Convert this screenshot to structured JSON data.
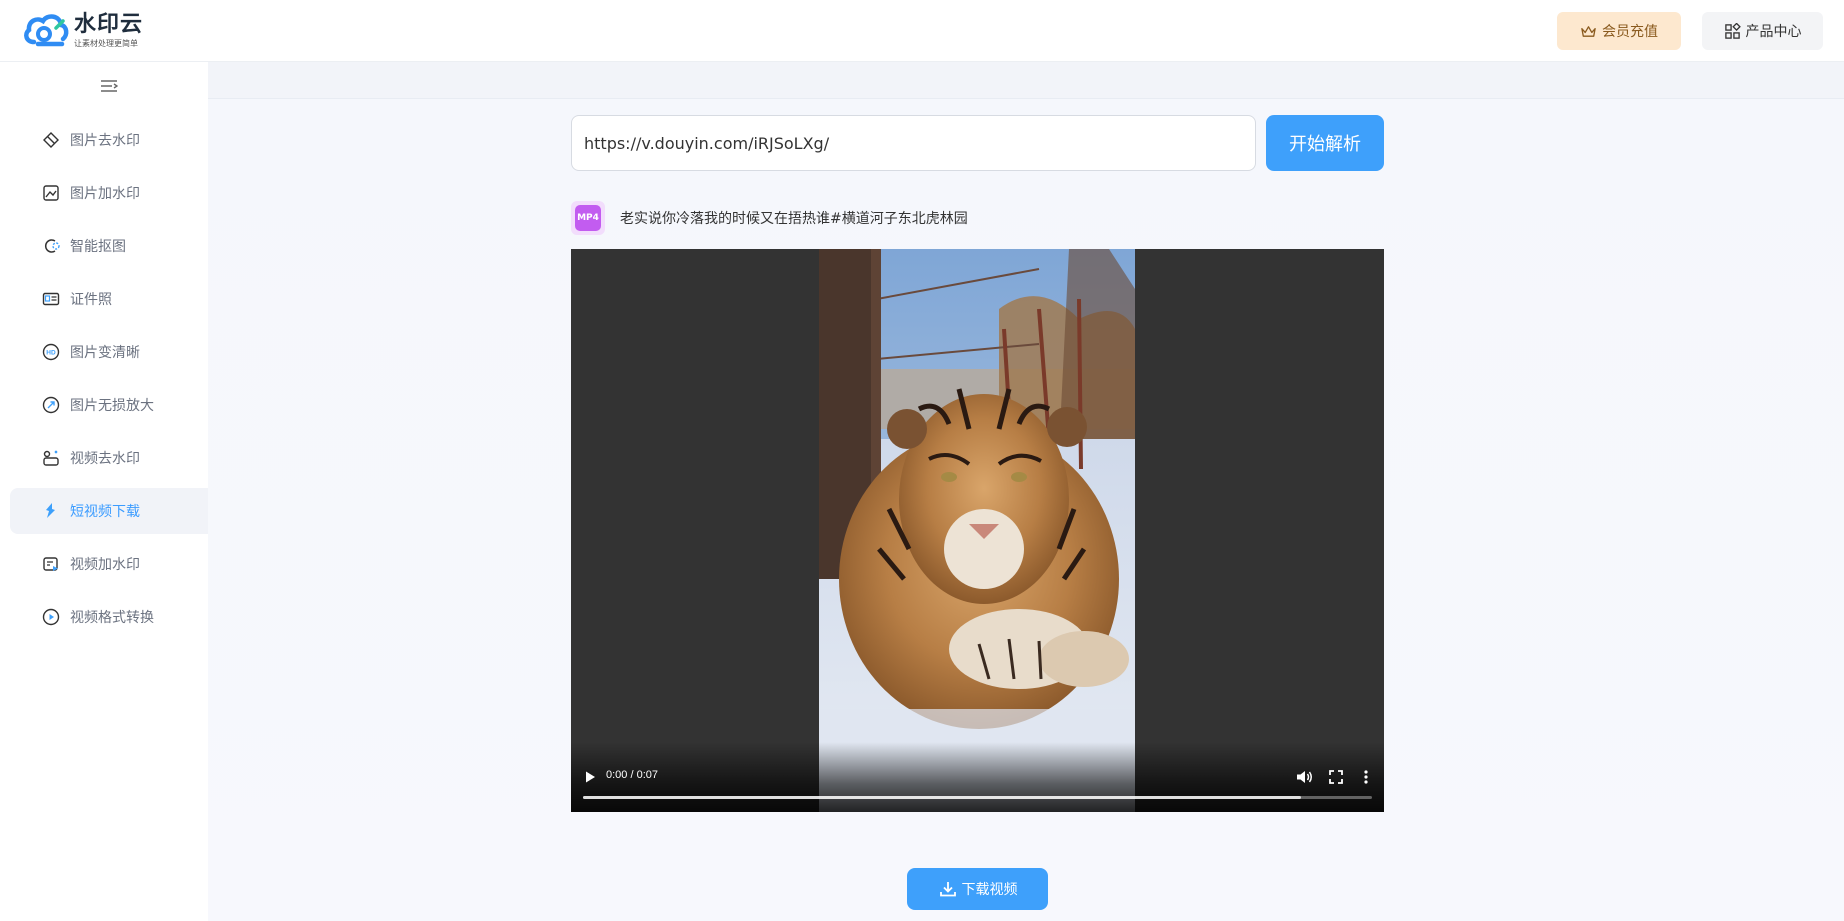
{
  "header": {
    "logo_title": "水印云",
    "logo_subtitle": "让素材处理更简单",
    "vip_label": "会员充值",
    "products_label": "产品中心"
  },
  "sidebar": {
    "items": [
      {
        "label": "图片去水印",
        "icon": "eraser-icon",
        "active": false
      },
      {
        "label": "图片加水印",
        "icon": "image-add-icon",
        "active": false
      },
      {
        "label": "智能抠图",
        "icon": "cutout-icon",
        "active": false
      },
      {
        "label": "证件照",
        "icon": "id-card-icon",
        "active": false
      },
      {
        "label": "图片变清晰",
        "icon": "hd-icon",
        "active": false
      },
      {
        "label": "图片无损放大",
        "icon": "enlarge-icon",
        "active": false
      },
      {
        "label": "视频去水印",
        "icon": "video-eraser-icon",
        "active": false
      },
      {
        "label": "短视频下载",
        "icon": "short-video-icon",
        "active": true
      },
      {
        "label": "视频加水印",
        "icon": "video-watermark-icon",
        "active": false
      },
      {
        "label": "视频格式转换",
        "icon": "video-convert-icon",
        "active": false
      }
    ]
  },
  "main": {
    "url_value": "https://v.douyin.com/iRJSoLXg/",
    "parse_label": "开始解析",
    "badge": "MP4",
    "video_title": "老实说你冷落我的时候又在捂热谁#横道河子东北虎林园",
    "player": {
      "time": "0:00 / 0:07",
      "buffered_fraction": 0.91
    },
    "download_label": "下载视频"
  },
  "colors": {
    "accent": "#3ea0fb",
    "vip_bg": "#fde8cf",
    "badge": "#c25cf0"
  }
}
